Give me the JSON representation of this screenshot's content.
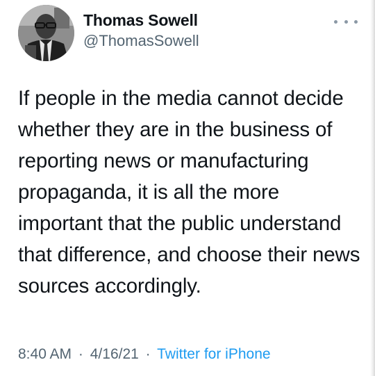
{
  "author": {
    "display_name": "Thomas Sowell",
    "handle": "@ThomasSowell"
  },
  "tweet": {
    "text": "If people in the media cannot decide whether they are in the business of reporting news or manufacturing propaganda, it is all the more important that the public understand that difference, and choose their news sources accordingly.",
    "time": "8:40 AM",
    "date": "4/16/21",
    "separator": "·",
    "source": "Twitter for iPhone"
  },
  "icons": {
    "more": "more-options-icon",
    "avatar": "profile-photo"
  },
  "colors": {
    "text": "#0f1419",
    "secondary": "#536471",
    "link": "#1d9bf0"
  }
}
